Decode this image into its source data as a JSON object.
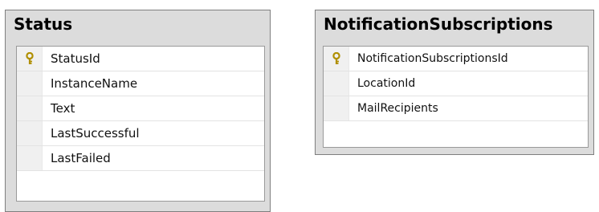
{
  "tables": [
    {
      "title": "Status",
      "columns": [
        {
          "name": "StatusId",
          "primary_key": true
        },
        {
          "name": "InstanceName",
          "primary_key": false
        },
        {
          "name": "Text",
          "primary_key": false
        },
        {
          "name": "LastSuccessful",
          "primary_key": false
        },
        {
          "name": "LastFailed",
          "primary_key": false
        }
      ]
    },
    {
      "title": "NotificationSubscriptions",
      "columns": [
        {
          "name": "NotificationSubscriptionsId",
          "primary_key": true
        },
        {
          "name": "LocationId",
          "primary_key": false
        },
        {
          "name": "MailRecipients",
          "primary_key": false
        }
      ]
    }
  ],
  "colors": {
    "key_icon": "#c9a800",
    "header_bg": "#dcdcdc"
  }
}
